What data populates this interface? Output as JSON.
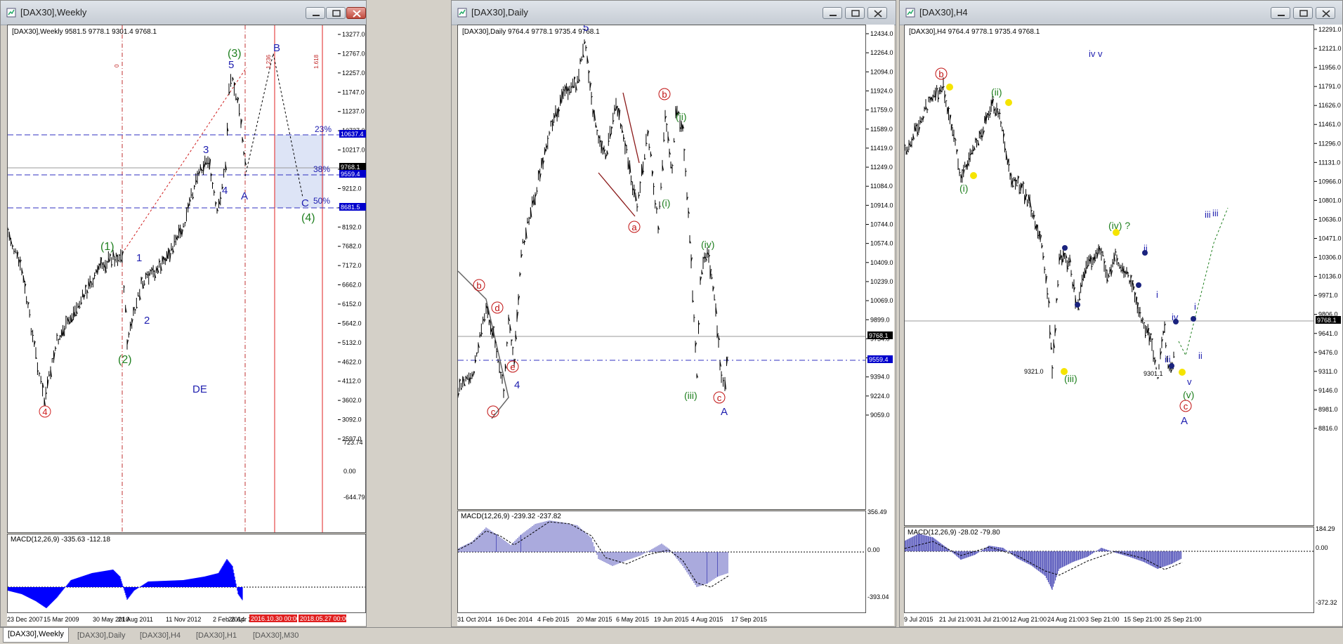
{
  "windows": [
    {
      "title": "[DAX30],Weekly",
      "header": "[DAX30],Weekly  9581.5 9778.1 9301.4 9768.1",
      "macd_label": "MACD(12,26,9) -335.63 -112.18",
      "price_ticks": [
        "13277.0",
        "12767.0",
        "12257.0",
        "11747.0",
        "11237.0",
        "10727.0",
        "10217.0",
        "9707.0",
        "9212.0",
        "8702.0",
        "8192.0",
        "7682.0",
        "7172.0",
        "6662.0",
        "6152.0",
        "5642.0",
        "5132.0",
        "4622.0",
        "4112.0",
        "3602.0",
        "3092.0",
        "2597.0"
      ],
      "macd_ticks": [
        "723.74",
        "0.00",
        "-644.79"
      ],
      "date_ticks": [
        "23 Dec 2007",
        "15 Mar 2009",
        "30 May 2010",
        "21 Aug 2011",
        "11 Nov 2012",
        "2 Feb 2014",
        "26 Apr 20"
      ],
      "date_badges": [
        "2016.10.30 00:00",
        "2018.05.27 00:00"
      ],
      "price_badges": [
        "10637.4",
        "9768.1",
        "9559.4",
        "8681.5"
      ],
      "fib_labels": [
        "23%",
        "38%",
        "50%"
      ],
      "fib_vertical_labels": [
        "0",
        "1.236",
        "1.618"
      ],
      "wave_labels": [
        "(3)",
        "5",
        "B",
        "3",
        "4",
        "A",
        "C",
        "(4)",
        "(1)",
        "1",
        "2",
        "(2)",
        "4",
        "DE"
      ]
    },
    {
      "title": "[DAX30],Daily",
      "header": "[DAX30],Daily  9764.4 9778.1 9735.4 9768.1",
      "macd_label": "MACD(12,26,9) -239.32 -237.82",
      "price_ticks": [
        "12434.0",
        "12264.0",
        "12094.0",
        "11924.0",
        "11759.0",
        "11589.0",
        "11419.0",
        "11249.0",
        "11084.0",
        "10914.0",
        "10744.0",
        "10574.0",
        "10409.0",
        "10239.0",
        "10069.0",
        "9899.0",
        "9734.0",
        "9564.0",
        "9394.0",
        "9224.0",
        "9059.0"
      ],
      "macd_ticks": [
        "356.49",
        "0.00",
        "-393.04"
      ],
      "date_ticks": [
        "31 Oct 2014",
        "16 Dec 2014",
        "4 Feb 2015",
        "20 Mar 2015",
        "6 May 2015",
        "19 Jun 2015",
        "4 Aug 2015",
        "17 Sep 2015"
      ],
      "price_badges": [
        "9768.1",
        "9559.4"
      ],
      "wave_labels": [
        "5",
        "b",
        "a",
        "(ii)",
        "(i)",
        "(iv)",
        "(iii)",
        "c",
        "A",
        "b",
        "d",
        "e",
        "4",
        "c"
      ]
    },
    {
      "title": "[DAX30],H4",
      "header": "[DAX30],H4  9764.4 9778.1 9735.4 9768.1",
      "macd_label": "MACD(12,26,9) -28.02 -79.80",
      "price_ticks": [
        "12291.0",
        "12121.0",
        "11956.0",
        "11791.0",
        "11626.0",
        "11461.0",
        "11296.0",
        "11131.0",
        "10966.0",
        "10801.0",
        "10636.0",
        "10471.0",
        "10306.0",
        "10136.0",
        "9971.0",
        "9806.0",
        "9641.0",
        "9476.0",
        "9311.0",
        "9146.0",
        "8981.0",
        "8816.0"
      ],
      "macd_ticks": [
        "184.29",
        "0.00",
        "-372.32"
      ],
      "date_ticks": [
        "9 Jul 2015",
        "21 Jul 21:00",
        "31 Jul 21:00",
        "12 Aug 21:00",
        "24 Aug 21:00",
        "3 Sep 21:00",
        "15 Sep 21:00",
        "25 Sep 21:00"
      ],
      "price_badges": [
        "9768.1"
      ],
      "value_boxes": [
        "9321.0",
        "9301.1"
      ],
      "wave_labels": [
        "iv v",
        "b",
        "(ii)",
        "(i)",
        "(iv) ?",
        "ii",
        "i",
        "iii",
        "(iii)",
        "iv",
        "i",
        "iii",
        "v",
        "(v)",
        "c",
        "A",
        "ii",
        "iii"
      ]
    }
  ],
  "tabs": [
    "[DAX30],Weekly",
    "[DAX30],Daily",
    "[DAX30],H4",
    "[DAX30],H1",
    "[DAX30],M30"
  ],
  "active_tab": 0,
  "colors": {
    "green": "#208020",
    "blue": "#2020b0",
    "red": "#c01010",
    "badge": "#0000cc",
    "fibzone": "#dde4f6",
    "macd_blue": "#0000ff",
    "macd_hatch": "#5555bb"
  }
}
